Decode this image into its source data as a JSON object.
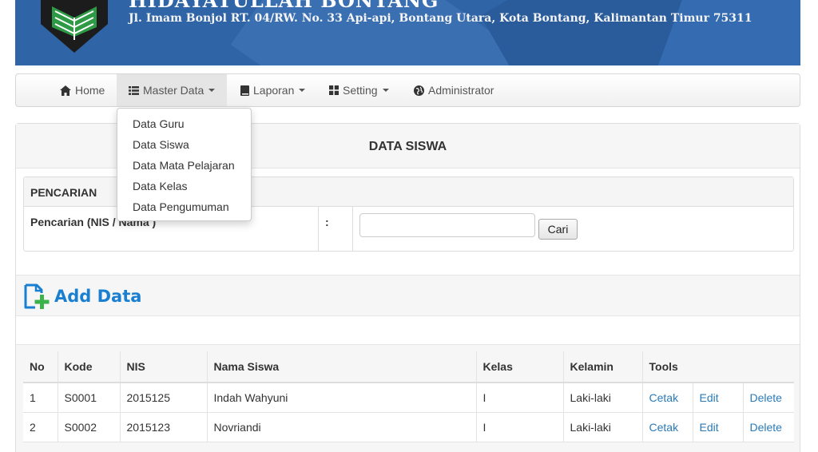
{
  "header": {
    "school_name": "HIDAYATULLAH BONTANG",
    "address": "Jl. Imam Bonjol RT. 04/RW. No. 33 Api-api, Bontang Utara, Kota Bontang, Kalimantan Timur 75311"
  },
  "nav": {
    "home": "Home",
    "master_data": "Master Data",
    "laporan": "Laporan",
    "setting": "Setting",
    "administrator": "Administrator"
  },
  "dropdown": {
    "items": [
      "Data Guru",
      "Data Siswa",
      "Data Mata Pelajaran",
      "Data Kelas",
      "Data Pengumuman"
    ]
  },
  "page": {
    "title": "DATA SISWA"
  },
  "search": {
    "title": "PENCARIAN",
    "label": "Pencarian (NIS / Nama )",
    "colon": ":",
    "value": "",
    "button": "Cari"
  },
  "add": {
    "label": "Add Data"
  },
  "table": {
    "headers": [
      "No",
      "Kode",
      "NIS",
      "Nama Siswa",
      "Kelas",
      "Kelamin",
      "Tools"
    ],
    "rows": [
      {
        "no": "1",
        "kode": "S0001",
        "nis": "2015125",
        "nama": "Indah Wahyuni",
        "kelas": "I",
        "kelamin": "Laki-laki",
        "cetak": "Cetak",
        "edit": "Edit",
        "delete": "Delete"
      },
      {
        "no": "2",
        "kode": "S0002",
        "nis": "2015123",
        "nama": "Novriandi",
        "kelas": "I",
        "kelamin": "Laki-laki",
        "cetak": "Cetak",
        "edit": "Edit",
        "delete": "Delete"
      }
    ]
  },
  "colors": {
    "banner": "#2f64a6",
    "link": "#2a7ab8",
    "add_blue": "#1a7fd0",
    "add_green": "#3cb34a"
  },
  "icons": {
    "home": "home-icon",
    "master_data": "list-icon",
    "laporan": "book-icon",
    "setting": "grid-icon",
    "administrator": "globe-icon",
    "add": "add-file-icon",
    "logo": "school-logo"
  }
}
